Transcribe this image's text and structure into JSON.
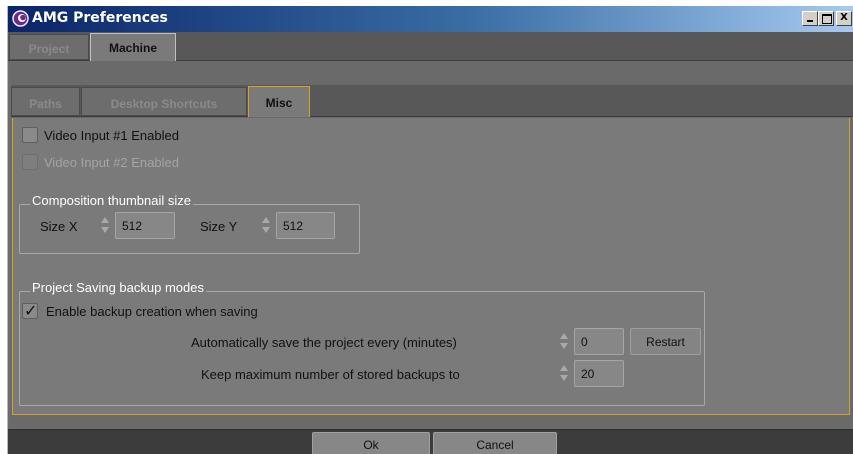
{
  "window": {
    "title": "AMG Preferences",
    "minimize": "_",
    "maximize": "□",
    "close": "X"
  },
  "outer_tabs": [
    {
      "label": "Project"
    },
    {
      "label": "Machine"
    }
  ],
  "inner_tabs": [
    {
      "label": "Paths"
    },
    {
      "label": "Desktop Shortcuts"
    },
    {
      "label": "Misc"
    }
  ],
  "misc": {
    "video1": {
      "label": "Video Input #1 Enabled",
      "checked": false
    },
    "video2": {
      "label": "Video Input #2 Enabled",
      "checked": false,
      "disabled": true
    },
    "thumbnail": {
      "title": "Composition thumbnail size",
      "size_x_label": "Size X",
      "size_x": "512",
      "size_y_label": "Size Y",
      "size_y": "512"
    },
    "backup": {
      "title": "Project Saving backup modes",
      "enable_label": "Enable backup creation when saving",
      "enable_checked": true,
      "autosave_label": "Automatically save the project every (minutes)",
      "autosave_value": "0",
      "restart_label": "Restart",
      "maxbackups_label": "Keep maximum number of stored backups to",
      "maxbackups_value": "20"
    }
  },
  "buttons": {
    "ok": "Ok",
    "cancel": "Cancel"
  },
  "colors": {
    "accent": "#d4a326",
    "titlebar": "#0a246a",
    "panel": "#7a7a7a"
  }
}
